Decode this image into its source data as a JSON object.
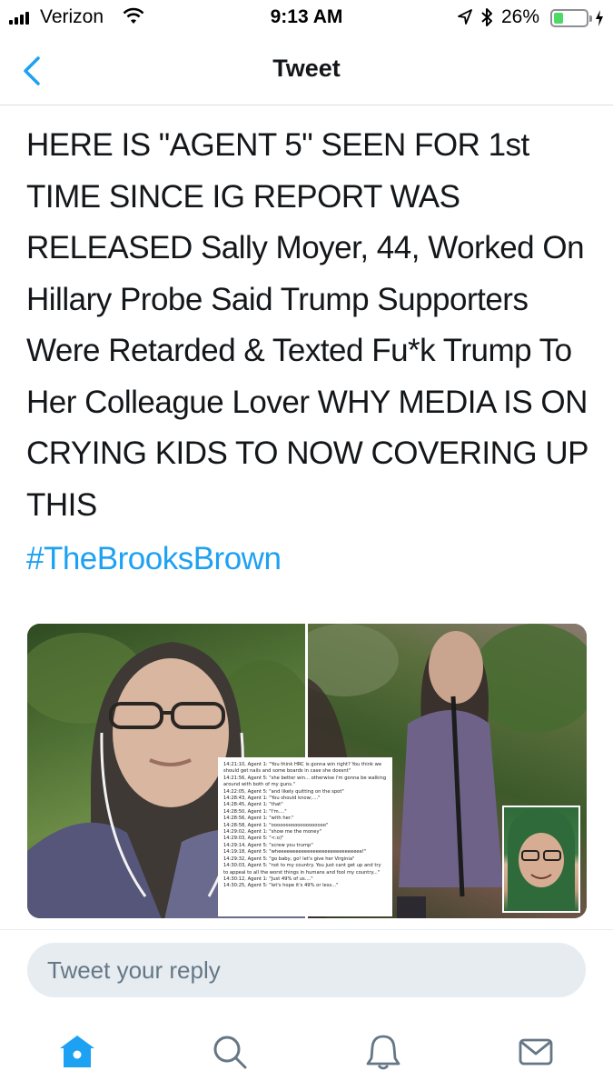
{
  "status_bar": {
    "carrier": "Verizon",
    "time": "9:13 AM",
    "battery_percent": "26%",
    "battery_level": 0.26,
    "icons": [
      "signal-icon",
      "wifi-icon",
      "location-icon",
      "bluetooth-icon",
      "battery-icon",
      "charging-icon"
    ]
  },
  "nav": {
    "title": "Tweet",
    "back_icon": "chevron-left-icon"
  },
  "tweet": {
    "text": "HERE IS \"AGENT 5\" SEEN FOR 1st TIME SINCE IG REPORT WAS RELEASED Sally Moyer, 44, Worked On Hillary Probe Said Trump Supporters Were Retarded & Texted Fu*k Trump To Her Colleague Lover WHY MEDIA IS ON CRYING KIDS TO NOW COVERING UP THIS",
    "hashtag": "#TheBrooksBrown"
  },
  "media": {
    "transcript": [
      "14:21:10, Agent 1: \"You think HRC is gonna win right? You think we should get nails and some boards in case she doesnt\"",
      "14:21:56, Agent 5: \"she better win... otherwise i'm gonna be walking around with both of my guns.\"",
      "14:22:05, Agent 5: \"and likely quitting on the spot\"",
      "14:28:43, Agent 1: \"You should know;....\"",
      "14:28:45, Agent 1: \"that\"",
      "14:28:50, Agent 1: \"I'm....\"",
      "14:28:56, Agent 1: \"with her.\"",
      "14:28:58, Agent 1: \"ooooooooooooooooooo\"",
      "14:29:02, Agent 1: \"show me the money\"",
      "14:29:03, Agent 5: \"<:o)\"",
      "14:29:14, Agent 5: \"screw you trump\"",
      "14:19:18, Agent 5: \"wheeeeeeeeeeeeeeeeeeeeeeeeeeeee!\"",
      "14:29:32, Agent 5: \"go baby, go! let's give her Virginia\"",
      "14:30:03, Agent 5: \"not to my country. You just cant get up and try to appeal to all the worst things in humans and fool my country...\"",
      "14:30:12, Agent 1: \"Just 49% of us....\"",
      "14:30:25, Agent 5: \"let's hope it's 49% or less...\""
    ]
  },
  "reply": {
    "placeholder": "Tweet your reply"
  },
  "tab_bar": {
    "tabs": [
      {
        "name": "home",
        "icon": "home-icon",
        "active": true
      },
      {
        "name": "search",
        "icon": "search-icon",
        "active": false
      },
      {
        "name": "notifications",
        "icon": "bell-icon",
        "active": false
      },
      {
        "name": "messages",
        "icon": "mail-icon",
        "active": false
      }
    ]
  },
  "colors": {
    "accent": "#1da1f2",
    "text": "#14171a",
    "muted": "#657786",
    "reply_bg": "#e6ecf0",
    "battery_fill": "#4cd964"
  }
}
